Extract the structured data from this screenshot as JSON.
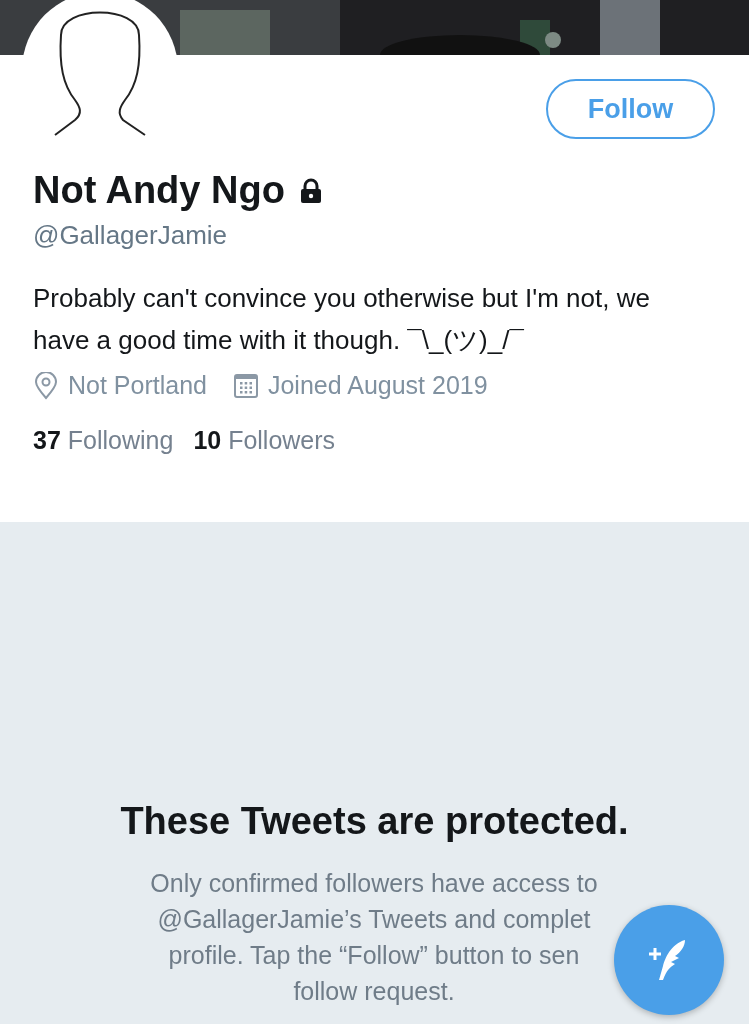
{
  "follow_button": {
    "label": "Follow"
  },
  "profile": {
    "name": "Not Andy Ngo",
    "protected": true,
    "handle": "@GallagerJamie",
    "bio": "Probably can't convince you otherwise but I'm not, we have a good time with it though. ¯\\_(ツ)_/¯",
    "location": "Not Portland",
    "joined": "Joined August 2019"
  },
  "stats": [
    {
      "count": "37",
      "label": "Following"
    },
    {
      "count": "10",
      "label": "Followers"
    }
  ],
  "protected_notice": {
    "title": "These Tweets are protected.",
    "message": "Only confirmed followers have access to @GallagerJamie’s Tweets and complet profile. Tap the “Follow” button to sen follow request."
  }
}
